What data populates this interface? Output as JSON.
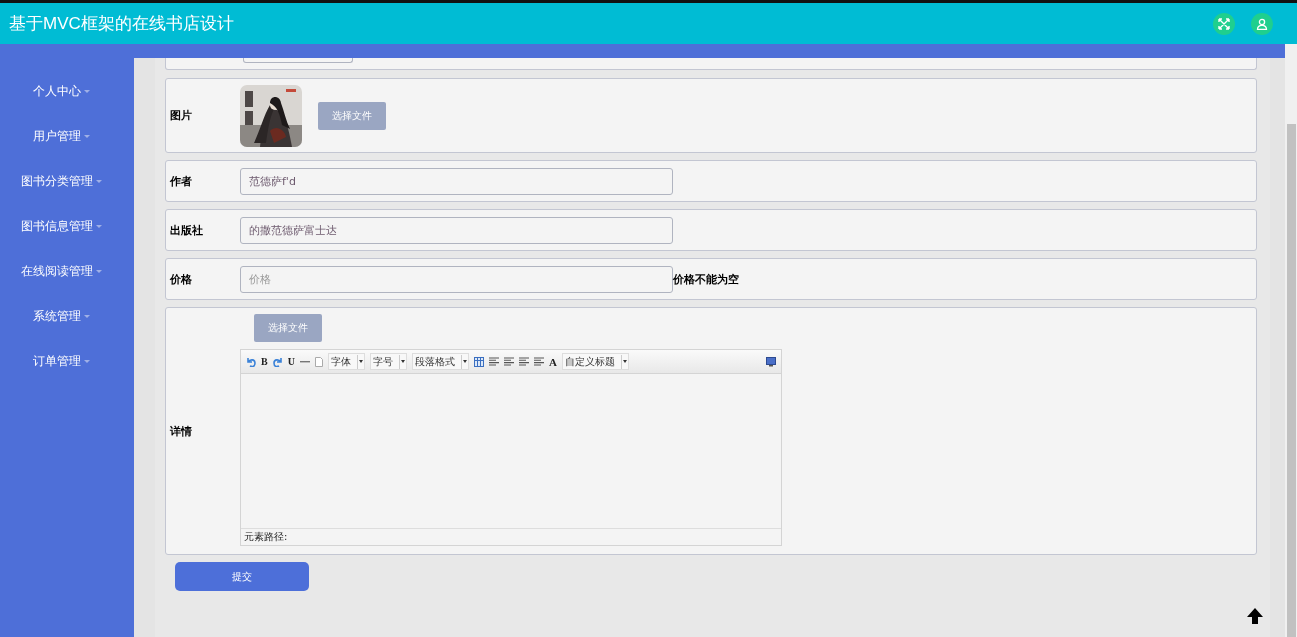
{
  "header": {
    "title": "基于MVC框架的在线书店设计"
  },
  "sidebar": {
    "items": [
      {
        "label": "个人中心"
      },
      {
        "label": "用户管理"
      },
      {
        "label": "图书分类管理"
      },
      {
        "label": "图书信息管理"
      },
      {
        "label": "在线阅读管理"
      },
      {
        "label": "系统管理"
      },
      {
        "label": "订单管理"
      }
    ]
  },
  "form": {
    "rows": [
      {
        "kind": "cut"
      },
      {
        "label": "图片",
        "button": "选择文件"
      },
      {
        "kind": "input",
        "label": "作者",
        "value": "范德萨f'd"
      },
      {
        "kind": "input",
        "label": "出版社",
        "value": "的撒范德萨富士达"
      },
      {
        "kind": "input",
        "label": "价格",
        "placeholder": "价格",
        "error": "价格不能为空"
      },
      {
        "kind": "editor",
        "label": "详情",
        "button": "选择文件",
        "path_label": "元素路径:",
        "toolbar": [
          {
            "kind": "undo"
          },
          {
            "kind": "text",
            "text": "B"
          },
          {
            "kind": "redo"
          },
          {
            "kind": "text",
            "text": "U"
          },
          {
            "kind": "rule"
          },
          {
            "kind": "page"
          },
          {
            "kind": "select",
            "text": "字体"
          },
          {
            "kind": "select",
            "text": "字号"
          },
          {
            "kind": "select",
            "text": "段落格式"
          },
          {
            "kind": "table"
          },
          {
            "kind": "align"
          },
          {
            "kind": "align"
          },
          {
            "kind": "align"
          },
          {
            "kind": "align"
          },
          {
            "kind": "color",
            "text": "A"
          },
          {
            "kind": "select",
            "text": "自定义标题"
          },
          {
            "kind": "preview"
          }
        ]
      }
    ],
    "submit": "提交"
  }
}
